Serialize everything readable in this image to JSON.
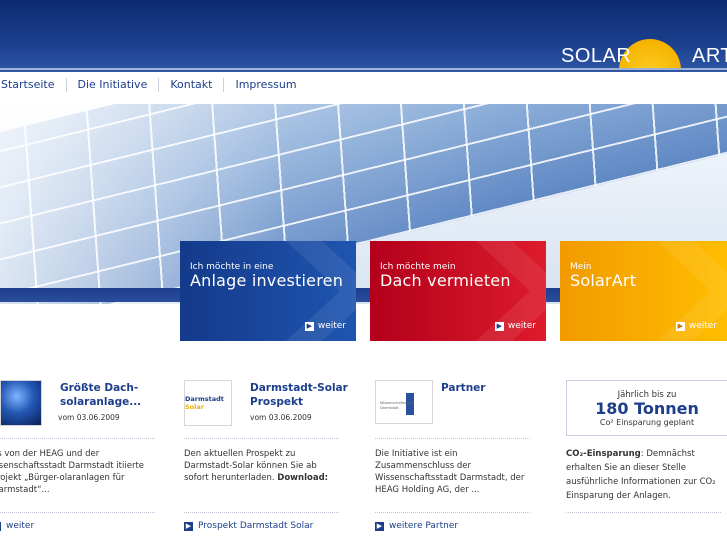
{
  "brand": {
    "logo_left": "SOLAR",
    "logo_right": "ART"
  },
  "nav": {
    "items": [
      "Startseite",
      "Die Initiative",
      "Kontakt",
      "Impressum"
    ]
  },
  "tiles": [
    {
      "small": "Ich möchte in eine",
      "big": "Anlage investieren",
      "more": "weiter"
    },
    {
      "small": "Ich möchte mein",
      "big": "Dach vermieten",
      "more": "weiter"
    },
    {
      "small": "Mein",
      "big": "SolarArt",
      "more": "weiter"
    }
  ],
  "news": [
    {
      "title": "Größte Dach-solaranlage...",
      "date": "vom 03.06.2009",
      "body": "as von der HEAG und der issenschaftsstadt Darmstadt itiierte Projekt „Bürger-olaranlagen für Darmstadt“...",
      "link": "weiter"
    },
    {
      "title": "Darmstadt-Solar Prospekt",
      "date": "vom 03.06.2009",
      "body": "Den aktuellen Prospekt zu Darmstadt-Solar können Sie ab sofort herunterladen.",
      "body_bold": "Download:",
      "link": "Prospekt Darmstadt Solar"
    },
    {
      "title": "Partner",
      "date": "",
      "body": "Die Initiative ist ein Zusammenschluss der Wissenschaftsstadt Darmstadt, der HEAG Holding AG, der ...",
      "link": "weitere Partner"
    }
  ],
  "thumbs": {
    "darmstadt": "Darmstadt",
    "solar": "Solar",
    "partner_caption": "Wissenschaftsstadt Darmstadt"
  },
  "co2": {
    "line1": "Jährlich bis zu",
    "line2": "180 Tonnen",
    "line3": "Co² Einsparung geplant",
    "text_bold": "CO₂-Einsparung",
    "text": ": Demnächst erhalten Sie an dieser Stelle ausführliche Informationen zur CO₂ Einsparung der Anlagen."
  },
  "colors": {
    "primary": "#1d3e8a",
    "header": "#0c2a70",
    "tile_blue": "#1f55b0",
    "tile_red": "#dd1c2c",
    "tile_orange": "#ffbe00"
  }
}
